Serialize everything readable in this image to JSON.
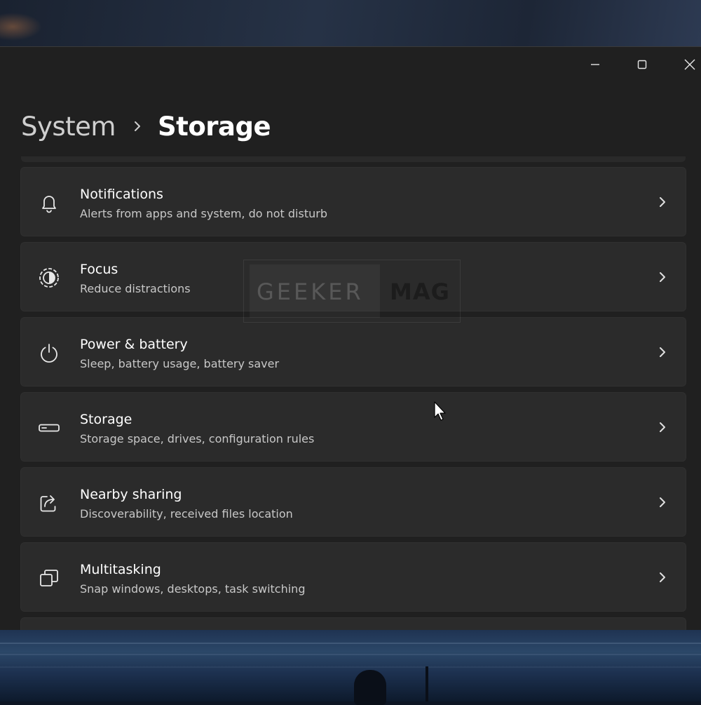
{
  "window": {
    "controls": {
      "minimize_icon": "minimize-icon",
      "maximize_icon": "maximize-icon",
      "close_icon": "close-icon"
    }
  },
  "breadcrumb": {
    "parent": "System",
    "separator_icon": "chevron-right-icon",
    "current": "Storage"
  },
  "settings_items": [
    {
      "title": "Notifications",
      "description": "Alerts from apps and system, do not disturb",
      "icon": "bell-icon"
    },
    {
      "title": "Focus",
      "description": "Reduce distractions",
      "icon": "focus-icon"
    },
    {
      "title": "Power & battery",
      "description": "Sleep, battery usage, battery saver",
      "icon": "power-icon"
    },
    {
      "title": "Storage",
      "description": "Storage space, drives, configuration rules",
      "icon": "storage-drive-icon"
    },
    {
      "title": "Nearby sharing",
      "description": "Discoverability, received files location",
      "icon": "share-icon"
    },
    {
      "title": "Multitasking",
      "description": "Snap windows, desktops, task switching",
      "icon": "multitasking-icon"
    }
  ],
  "watermark": {
    "left_text": "GEEKER",
    "right_text": "MAG"
  },
  "colors": {
    "window_bg": "#202020",
    "card_bg": "#2b2b2b",
    "text_primary": "#ffffff",
    "text_secondary": "#c8c8c8"
  }
}
